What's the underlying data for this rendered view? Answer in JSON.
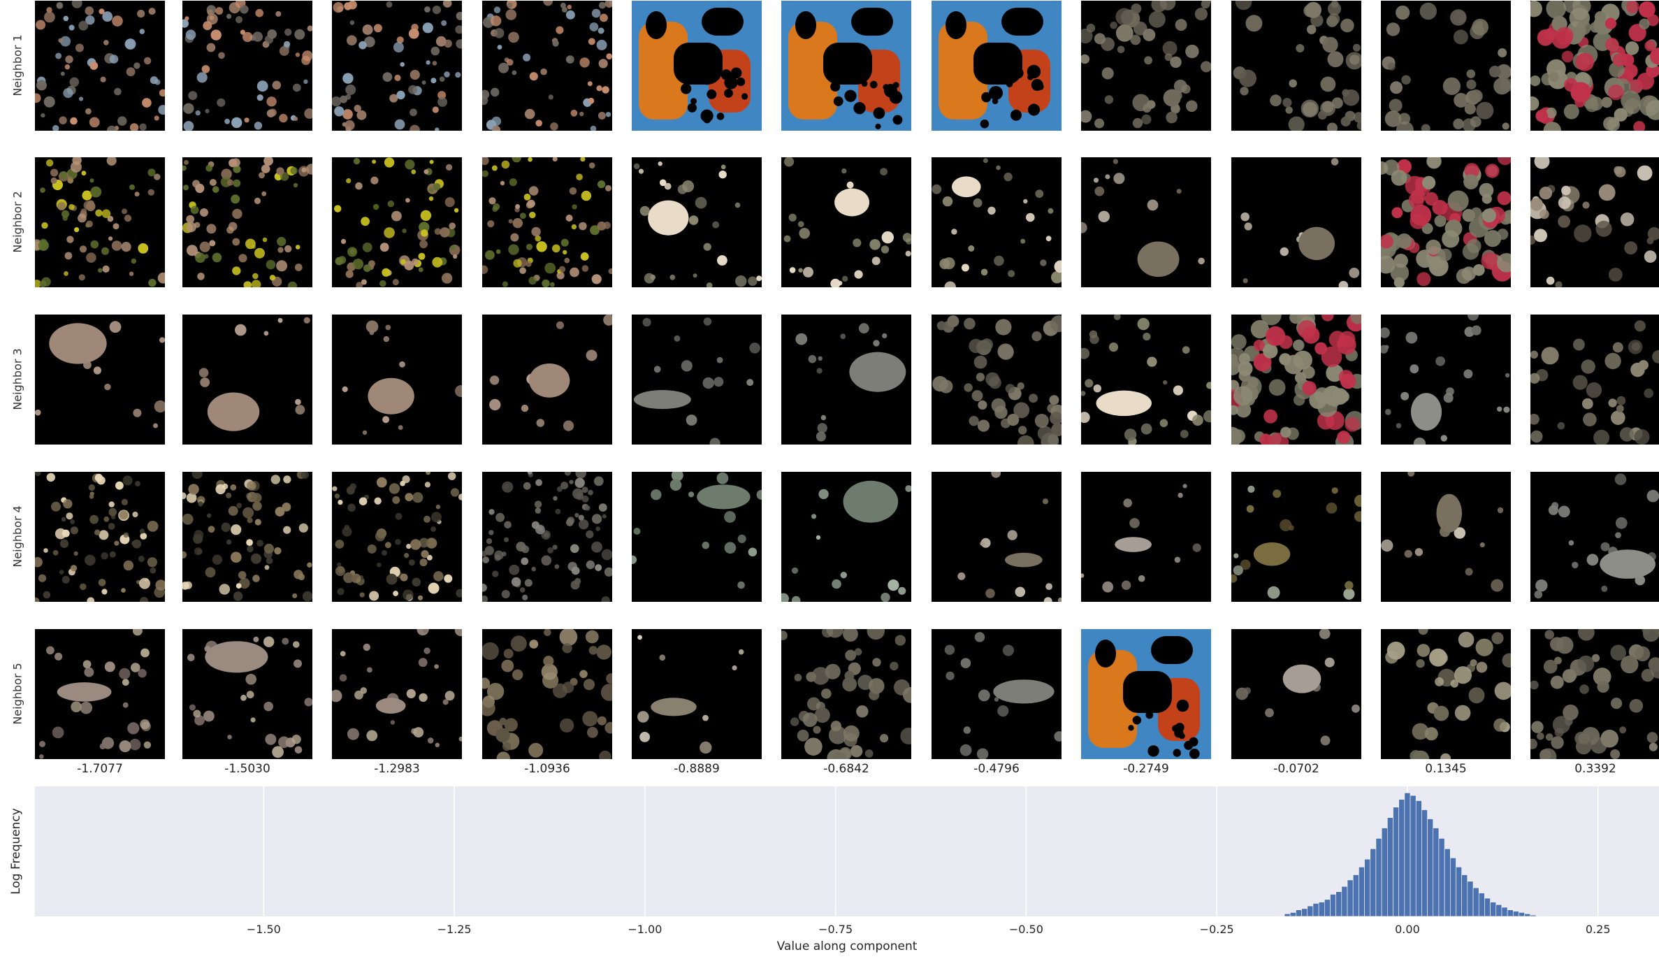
{
  "colors": {
    "hist_background": "#eaeaf2",
    "bar_fill": "#4c72b0",
    "grid": "#ffffff",
    "tile_background": "#000000"
  },
  "rows": [
    {
      "label": "Neighbor 1",
      "tiles": [
        {
          "kind": "scatter",
          "palette": [
            "#c98e6e",
            "#9a7a66",
            "#6e6860",
            "#8aa0b4"
          ],
          "count": 60
        },
        {
          "kind": "scatter",
          "palette": [
            "#c98e6e",
            "#9a7a66",
            "#6e6860",
            "#8aa0b4"
          ],
          "count": 60
        },
        {
          "kind": "scatter",
          "palette": [
            "#c98e6e",
            "#9a7a66",
            "#6e6860",
            "#8aa0b4"
          ],
          "count": 60
        },
        {
          "kind": "scatter",
          "palette": [
            "#c98e6e",
            "#9a7a66",
            "#6e6860",
            "#8aa0b4"
          ],
          "count": 60
        },
        {
          "kind": "orange",
          "palette": [
            "#d9781c",
            "#c4421a",
            "#3f86c2"
          ],
          "count": 0
        },
        {
          "kind": "orange",
          "palette": [
            "#d9781c",
            "#c4421a",
            "#3f86c2"
          ],
          "count": 0
        },
        {
          "kind": "orange",
          "palette": [
            "#d9781c",
            "#c4421a",
            "#3f86c2"
          ],
          "count": 0
        },
        {
          "kind": "blobs",
          "palette": [
            "#6f6a5c",
            "#5e5a4f",
            "#7d7868"
          ],
          "count": 45
        },
        {
          "kind": "blobs",
          "palette": [
            "#6f6a5c",
            "#5e5a4f",
            "#7d7868"
          ],
          "count": 40
        },
        {
          "kind": "blobs",
          "palette": [
            "#6f6a5c",
            "#5e5a4f",
            "#7d7868"
          ],
          "count": 35
        },
        {
          "kind": "dense",
          "palette": [
            "#8c8a74",
            "#7c7a66",
            "#c0324a"
          ],
          "count": 90
        }
      ]
    },
    {
      "label": "Neighbor 2",
      "tiles": [
        {
          "kind": "scatter",
          "palette": [
            "#5e6e2c",
            "#8a6e56",
            "#b49278",
            "#c8c020"
          ],
          "count": 70
        },
        {
          "kind": "scatter",
          "palette": [
            "#5e6e2c",
            "#8a6e56",
            "#b49278",
            "#c8c020"
          ],
          "count": 70
        },
        {
          "kind": "scatter",
          "palette": [
            "#5e6e2c",
            "#8a6e56",
            "#b49278",
            "#c8c020"
          ],
          "count": 70
        },
        {
          "kind": "scatter",
          "palette": [
            "#5e6e2c",
            "#8a6e56",
            "#b49278",
            "#c8c020"
          ],
          "count": 70
        },
        {
          "kind": "sparse",
          "palette": [
            "#8c8a70",
            "#e8dcc8",
            "#6a6858"
          ],
          "count": 25
        },
        {
          "kind": "sparse",
          "palette": [
            "#8c8a70",
            "#e8dcc8",
            "#6a6858"
          ],
          "count": 25
        },
        {
          "kind": "sparse",
          "palette": [
            "#8c8a70",
            "#e8dcc8",
            "#6a6858"
          ],
          "count": 25
        },
        {
          "kind": "sparse",
          "palette": [
            "#a49a8c",
            "#7a7060",
            "#c8bfb0"
          ],
          "count": 10
        },
        {
          "kind": "sparse",
          "palette": [
            "#a49a8c",
            "#7a7060",
            "#c8bfb0"
          ],
          "count": 10
        },
        {
          "kind": "dense",
          "palette": [
            "#8c8a74",
            "#7c7a66",
            "#c0324a"
          ],
          "count": 80
        },
        {
          "kind": "blobs",
          "palette": [
            "#9a8c7a",
            "#cfc6b8",
            "#5c5448"
          ],
          "count": 30
        }
      ]
    },
    {
      "label": "Neighbor 3",
      "tiles": [
        {
          "kind": "sparse",
          "palette": [
            "#b8a090",
            "#a08878",
            "#8c7868"
          ],
          "count": 10
        },
        {
          "kind": "sparse",
          "palette": [
            "#b8a090",
            "#a08878",
            "#8c7868"
          ],
          "count": 10
        },
        {
          "kind": "sparse",
          "palette": [
            "#b8a090",
            "#a08878",
            "#8c7868"
          ],
          "count": 10
        },
        {
          "kind": "sparse",
          "palette": [
            "#b8a090",
            "#a08878",
            "#8c7868"
          ],
          "count": 10
        },
        {
          "kind": "sparse",
          "palette": [
            "#6e6e6a",
            "#7e7e78",
            "#5e5e5a"
          ],
          "count": 12
        },
        {
          "kind": "sparse",
          "palette": [
            "#6e6e6a",
            "#7e7e78",
            "#5e5e5a"
          ],
          "count": 12
        },
        {
          "kind": "blobs",
          "palette": [
            "#6f6a5c",
            "#5e5a4f",
            "#7d7868"
          ],
          "count": 45
        },
        {
          "kind": "sparse",
          "palette": [
            "#8c8a70",
            "#e8dcc8",
            "#6a6858"
          ],
          "count": 25
        },
        {
          "kind": "dense",
          "palette": [
            "#8c8a74",
            "#7c7a66",
            "#c0324a"
          ],
          "count": 80
        },
        {
          "kind": "sparse",
          "palette": [
            "#7c7c78",
            "#8e8e88",
            "#6a6a66"
          ],
          "count": 22
        },
        {
          "kind": "blobs",
          "palette": [
            "#6a6658",
            "#8a8470",
            "#4e4a40"
          ],
          "count": 30
        }
      ]
    },
    {
      "label": "Neighbor 4",
      "tiles": [
        {
          "kind": "scatter",
          "palette": [
            "#3e3a30",
            "#8c7a5c",
            "#e8d8b8",
            "#6a6048"
          ],
          "count": 70
        },
        {
          "kind": "scatter",
          "palette": [
            "#3e3a30",
            "#8c7a5c",
            "#e8d8b8",
            "#6a6048"
          ],
          "count": 70
        },
        {
          "kind": "scatter",
          "palette": [
            "#3e3a30",
            "#8c7a5c",
            "#e8d8b8",
            "#6a6048"
          ],
          "count": 70
        },
        {
          "kind": "scatter",
          "palette": [
            "#5a5650",
            "#6c6860",
            "#8a8680",
            "#4a4640"
          ],
          "count": 80
        },
        {
          "kind": "sparse",
          "palette": [
            "#8c9c8c",
            "#6e7c6e",
            "#a8b8a6"
          ],
          "count": 14
        },
        {
          "kind": "sparse",
          "palette": [
            "#8c9c8c",
            "#6e7c6e",
            "#a8b8a6"
          ],
          "count": 14
        },
        {
          "kind": "sparse",
          "palette": [
            "#a49a8c",
            "#7a7060",
            "#c8bfb0"
          ],
          "count": 12
        },
        {
          "kind": "sparse",
          "palette": [
            "#8a8278",
            "#a69e94",
            "#6e665c"
          ],
          "count": 10
        },
        {
          "kind": "sparse",
          "palette": [
            "#9eaa96",
            "#7a6e40",
            "#5c5030"
          ],
          "count": 16
        },
        {
          "kind": "sparse",
          "palette": [
            "#a49a8c",
            "#7a7060",
            "#c8bfb0"
          ],
          "count": 10
        },
        {
          "kind": "sparse",
          "palette": [
            "#7c7c78",
            "#8e8e88",
            "#6a6a66"
          ],
          "count": 18
        }
      ]
    },
    {
      "label": "Neighbor 5",
      "tiles": [
        {
          "kind": "sparse",
          "palette": [
            "#7c6c68",
            "#9a8a80",
            "#b0a48e"
          ],
          "count": 26
        },
        {
          "kind": "sparse",
          "palette": [
            "#7c6c68",
            "#9a8a80",
            "#b0a48e"
          ],
          "count": 26
        },
        {
          "kind": "sparse",
          "palette": [
            "#7c6c68",
            "#9a8a80",
            "#b0a48e"
          ],
          "count": 26
        },
        {
          "kind": "blobs",
          "palette": [
            "#9a8c70",
            "#7c6e56",
            "#5e5444"
          ],
          "count": 40
        },
        {
          "kind": "sparse",
          "palette": [
            "#b4aa98",
            "#8a8070",
            "#d8d0c0"
          ],
          "count": 8
        },
        {
          "kind": "blobs",
          "palette": [
            "#6f6a5c",
            "#5e5a4f",
            "#7d7868"
          ],
          "count": 45
        },
        {
          "kind": "sparse",
          "palette": [
            "#6e6e6a",
            "#7e7e78",
            "#5e5e5a"
          ],
          "count": 12
        },
        {
          "kind": "orange",
          "palette": [
            "#d9781c",
            "#c4421a",
            "#3f86c2"
          ],
          "count": 0
        },
        {
          "kind": "sparse",
          "palette": [
            "#8a8278",
            "#a69e94",
            "#6e665c"
          ],
          "count": 8
        },
        {
          "kind": "blobs",
          "palette": [
            "#8a846c",
            "#6e6a58",
            "#a8a088"
          ],
          "count": 30
        },
        {
          "kind": "blobs",
          "palette": [
            "#6f6a5c",
            "#5e5a4f",
            "#7d7868"
          ],
          "count": 50
        }
      ]
    }
  ],
  "column_values": [
    "-1.7077",
    "-1.5030",
    "-1.2983",
    "-1.0936",
    "-0.8889",
    "-0.6842",
    "-0.4796",
    "-0.2749",
    "-0.0702",
    "0.1345",
    "0.3392"
  ],
  "chart_data": {
    "type": "bar",
    "ylabel": "Log Frequency",
    "xlabel": "Value along component",
    "xlim": [
      -1.8,
      0.33
    ],
    "x_ticks": [
      -1.5,
      -1.25,
      -1.0,
      -0.75,
      -0.5,
      -0.25,
      0.0,
      0.25
    ],
    "x_tick_labels": [
      "−1.50",
      "−1.25",
      "−1.00",
      "−0.75",
      "−0.50",
      "−0.25",
      "0.00",
      "0.25"
    ],
    "grid": true,
    "bin_width": 0.0075,
    "bins": [
      {
        "x": -0.1575,
        "y": 0.02
      },
      {
        "x": -0.15,
        "y": 0.03
      },
      {
        "x": -0.1425,
        "y": 0.05
      },
      {
        "x": -0.135,
        "y": 0.06
      },
      {
        "x": -0.1275,
        "y": 0.08
      },
      {
        "x": -0.12,
        "y": 0.1
      },
      {
        "x": -0.1125,
        "y": 0.11
      },
      {
        "x": -0.105,
        "y": 0.13
      },
      {
        "x": -0.0975,
        "y": 0.17
      },
      {
        "x": -0.09,
        "y": 0.19
      },
      {
        "x": -0.0825,
        "y": 0.23
      },
      {
        "x": -0.075,
        "y": 0.28
      },
      {
        "x": -0.0675,
        "y": 0.32
      },
      {
        "x": -0.06,
        "y": 0.38
      },
      {
        "x": -0.0525,
        "y": 0.44
      },
      {
        "x": -0.045,
        "y": 0.52
      },
      {
        "x": -0.0375,
        "y": 0.6
      },
      {
        "x": -0.03,
        "y": 0.68
      },
      {
        "x": -0.0225,
        "y": 0.76
      },
      {
        "x": -0.015,
        "y": 0.84
      },
      {
        "x": -0.0075,
        "y": 0.9
      },
      {
        "x": 0.0,
        "y": 0.95
      },
      {
        "x": 0.0075,
        "y": 0.93
      },
      {
        "x": 0.015,
        "y": 0.89
      },
      {
        "x": 0.0225,
        "y": 0.82
      },
      {
        "x": 0.03,
        "y": 0.75
      },
      {
        "x": 0.0375,
        "y": 0.68
      },
      {
        "x": 0.045,
        "y": 0.6
      },
      {
        "x": 0.0525,
        "y": 0.52
      },
      {
        "x": 0.06,
        "y": 0.45
      },
      {
        "x": 0.0675,
        "y": 0.38
      },
      {
        "x": 0.075,
        "y": 0.32
      },
      {
        "x": 0.0825,
        "y": 0.27
      },
      {
        "x": 0.09,
        "y": 0.22
      },
      {
        "x": 0.0975,
        "y": 0.18
      },
      {
        "x": 0.105,
        "y": 0.14
      },
      {
        "x": 0.1125,
        "y": 0.11
      },
      {
        "x": 0.12,
        "y": 0.09
      },
      {
        "x": 0.1275,
        "y": 0.07
      },
      {
        "x": 0.135,
        "y": 0.05
      },
      {
        "x": 0.1425,
        "y": 0.04
      },
      {
        "x": 0.15,
        "y": 0.03
      },
      {
        "x": 0.1575,
        "y": 0.02
      },
      {
        "x": 0.165,
        "y": 0.01
      }
    ]
  }
}
